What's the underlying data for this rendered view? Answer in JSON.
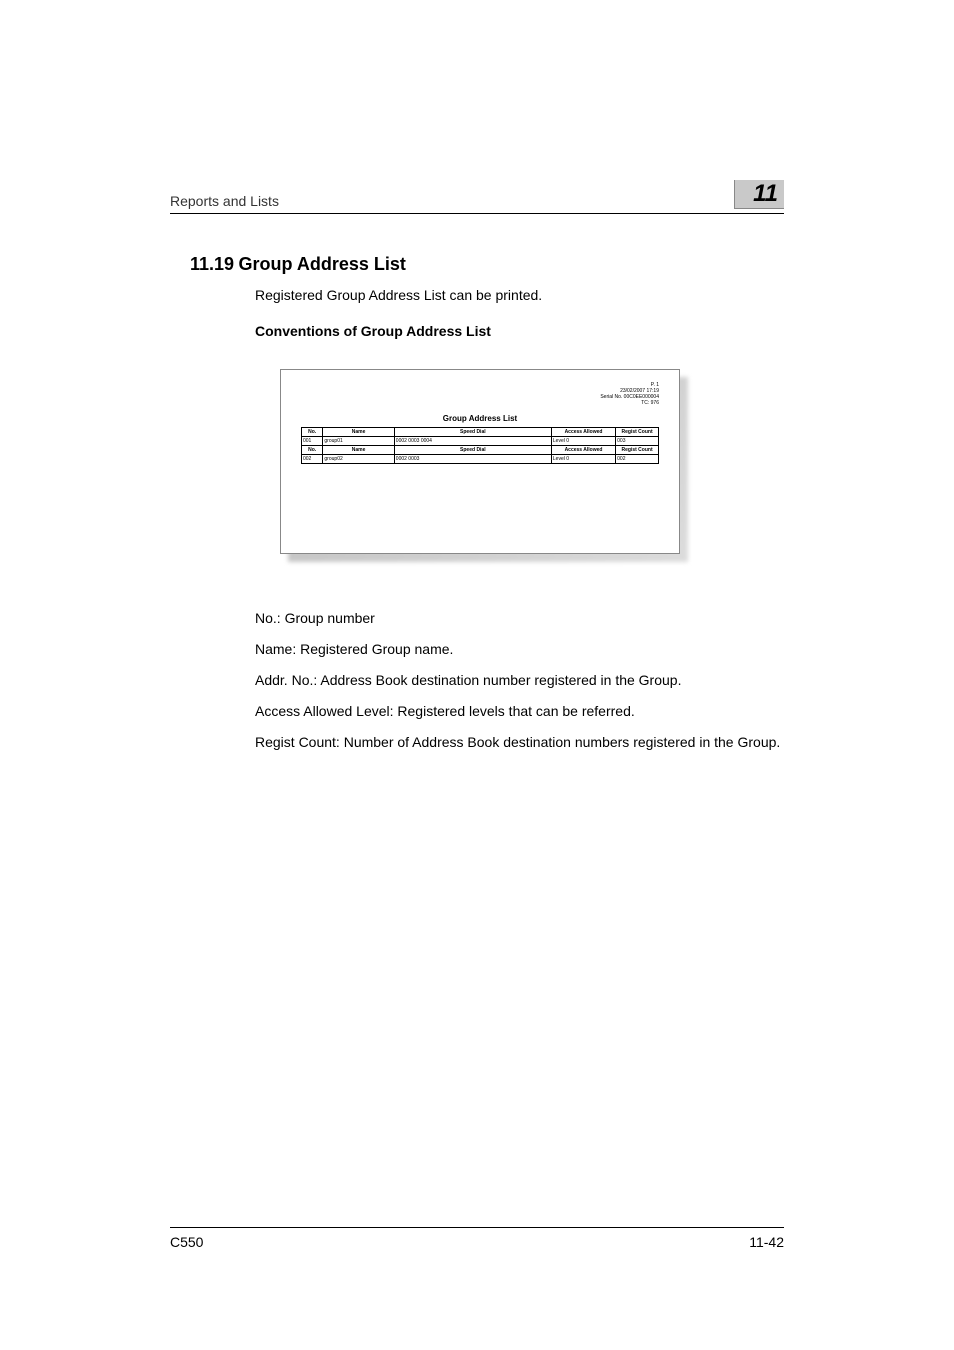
{
  "header": {
    "left": "Reports and Lists",
    "chapter": "11"
  },
  "section": {
    "number": "11.19",
    "title": "Group Address List"
  },
  "intro": "Registered Group Address List can be printed.",
  "subhead": "Conventions of Group Address List",
  "figure": {
    "title": "Group Address List",
    "meta_p": "P. 1",
    "meta_date": "23/02/2007 17:19",
    "meta_serial": "Serial No.   00C0EE000004",
    "meta_tc": "TC:                     976",
    "columns": {
      "no": "No.",
      "name": "Name",
      "speed_dial": "Speed Dial",
      "access": "Access Allowed",
      "regist": "Regist Count"
    },
    "rows": [
      {
        "no": "001",
        "name": "group01",
        "speed": "0002 0003 0004",
        "access": "Level 0",
        "regist": "003"
      },
      {
        "no": "002",
        "name": "group02",
        "speed": "0002 0003",
        "access": "Level 0",
        "regist": "002"
      }
    ]
  },
  "definitions": {
    "d1": "No.: Group number",
    "d2": "Name: Registered Group name.",
    "d3": "Addr. No.: Address Book destination number registered in the Group.",
    "d4": "Access Allowed Level: Registered levels that can be referred.",
    "d5": "Regist Count: Number of Address Book destination numbers registered in the Group."
  },
  "footer": {
    "left": "C550",
    "right": "11-42"
  }
}
